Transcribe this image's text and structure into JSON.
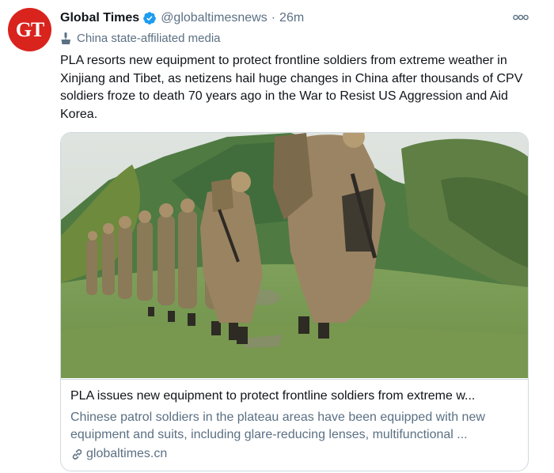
{
  "tweet": {
    "avatar_text": "GT",
    "author_name": "Global Times",
    "handle": "@globaltimesnews",
    "separator": "·",
    "time": "26m",
    "more_label": "ooo",
    "state_label": "China state-affiliated media",
    "text": "PLA resorts new equipment to protect frontline soldiers from extreme weather in Xinjiang and Tibet, as netizens hail huge changes in China after thousands of CPV soldiers froze to death 70 years ago in the War to Resist US Aggression and Aid Korea."
  },
  "card": {
    "title": "PLA issues new equipment to protect frontline soldiers from extreme w...",
    "description": "Chinese patrol soldiers in the plateau areas have been equipped with new equipment and suits, including glare-reducing lenses, multifunctional ...",
    "domain": "globaltimes.cn"
  },
  "colors": {
    "avatar_bg": "#d9231d",
    "verified_blue": "#1d9bf0",
    "secondary_text": "#5b7083",
    "border": "#cfd9de"
  },
  "icons": {
    "verified": "verified-badge-icon",
    "state_media": "podium-icon",
    "more": "more-dots-icon",
    "link": "link-icon"
  }
}
